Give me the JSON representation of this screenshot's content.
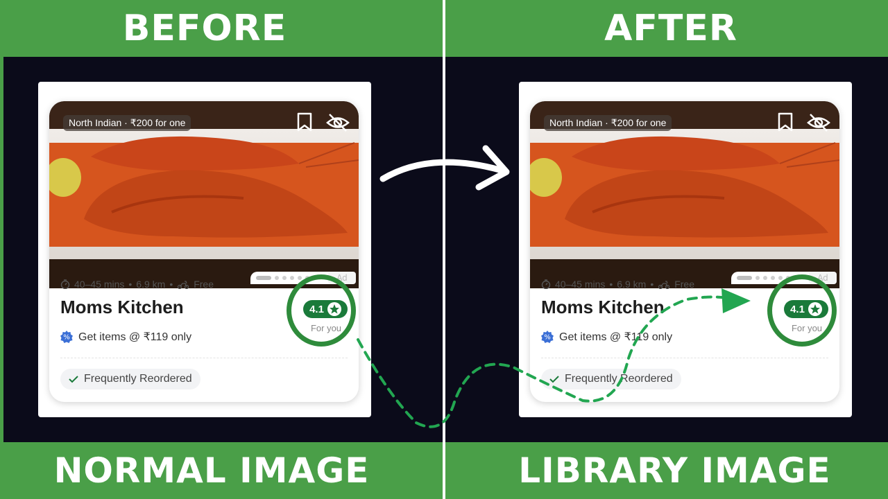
{
  "banners": {
    "before": "BEFORE",
    "after": "AFTER",
    "normal_image": "NORMAL IMAGE",
    "library_image": "LIBRARY IMAGE"
  },
  "card": {
    "tag": "North Indian · ₹200 for one",
    "delivery_time": "40–45 mins",
    "distance": "6.9 km",
    "delivery_fee": "Free",
    "restaurant_name": "Moms Kitchen",
    "offer": "Get items @ ₹119 only",
    "rating": "4.1",
    "rating_caption": "For you",
    "reorder_label": "Frequently Reordered",
    "ad_label": "Ad"
  },
  "colors": {
    "banner_green": "#4a9f48",
    "background": "#0b0b1a",
    "rating_green": "#1a7a3a",
    "highlight_green": "#2e8b3b",
    "dashed_arrow_green": "#22a651",
    "offer_blue": "#3b6fd6"
  },
  "icons": [
    "bookmark-icon",
    "hide-eye-icon",
    "timer-icon",
    "scooter-icon",
    "offer-badge-icon",
    "star-icon",
    "check-icon"
  ]
}
